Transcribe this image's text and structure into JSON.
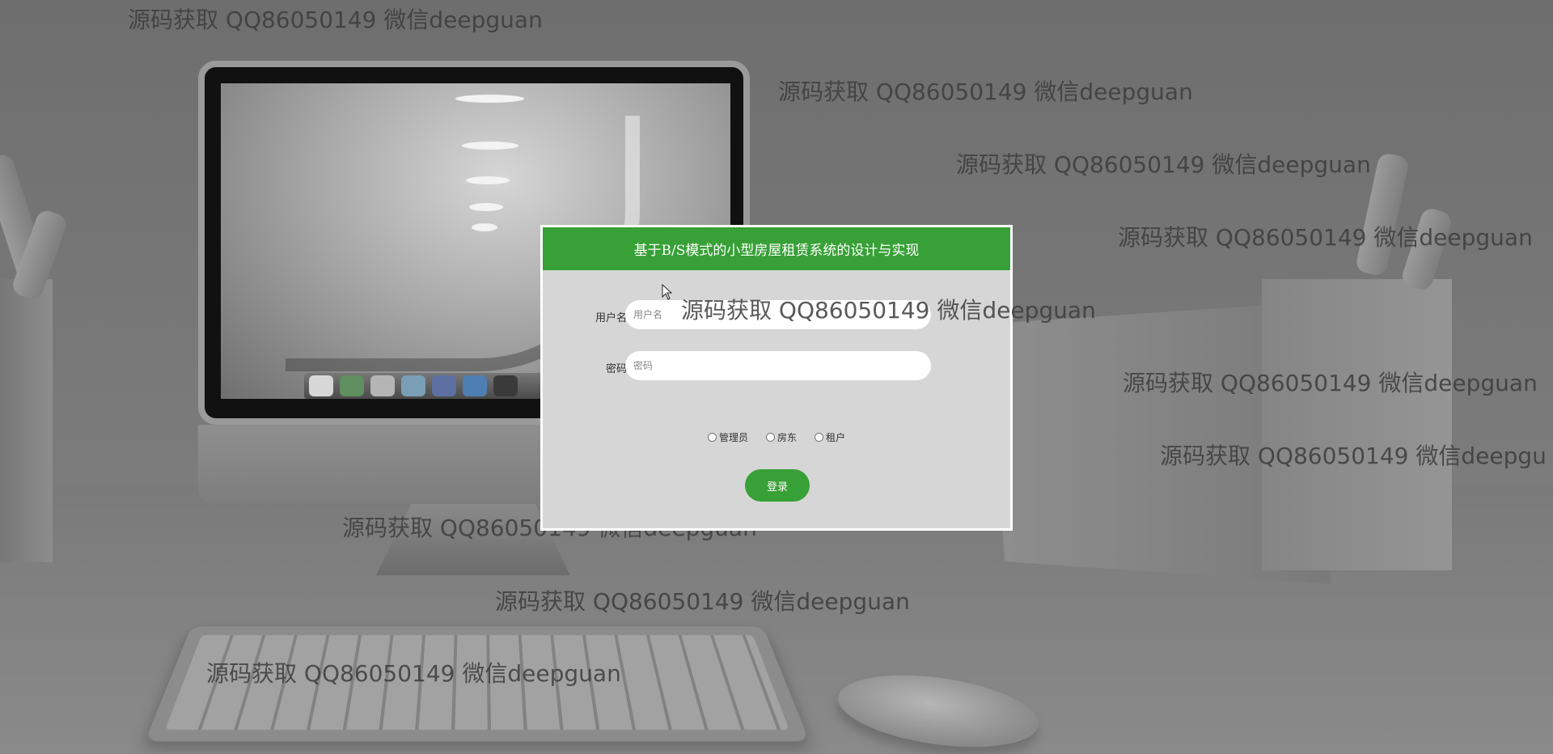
{
  "page": {
    "title": "基于B/S模式的小型房屋租赁系统的设计与实现"
  },
  "login": {
    "username_label": "用户名",
    "username_placeholder": "用户名",
    "username_value": "",
    "password_label": "密码",
    "password_placeholder": "密码",
    "password_value": "",
    "roles": [
      {
        "label": "管理员",
        "checked": false
      },
      {
        "label": "房东",
        "checked": false
      },
      {
        "label": "租户",
        "checked": false
      }
    ],
    "submit_label": "登录"
  },
  "watermarks": [
    {
      "text": "源码获取 QQ86050149 微信deepguan"
    },
    {
      "text": "源码获取 QQ86050149 微信deepguan"
    },
    {
      "text": "源码获取 QQ86050149 微信deepguan"
    },
    {
      "text": "源码获取 QQ86050149 微信deepguan"
    },
    {
      "text": "源码获取 QQ86050149 微信deepguan"
    },
    {
      "text": "源码获取 QQ86050149 微信deepguan"
    },
    {
      "text": "源码获取 QQ86050149 微信deepgu"
    },
    {
      "text": "源码获取 QQ86050149 微信deepguan"
    },
    {
      "text": "源码获取 QQ86050149 微信deepguan"
    },
    {
      "text": "源码获取 QQ86050149 微信deepguan"
    }
  ],
  "colors": {
    "header_green": "#37a036",
    "panel_bg": "#d6d6d6",
    "background": "#777777"
  }
}
